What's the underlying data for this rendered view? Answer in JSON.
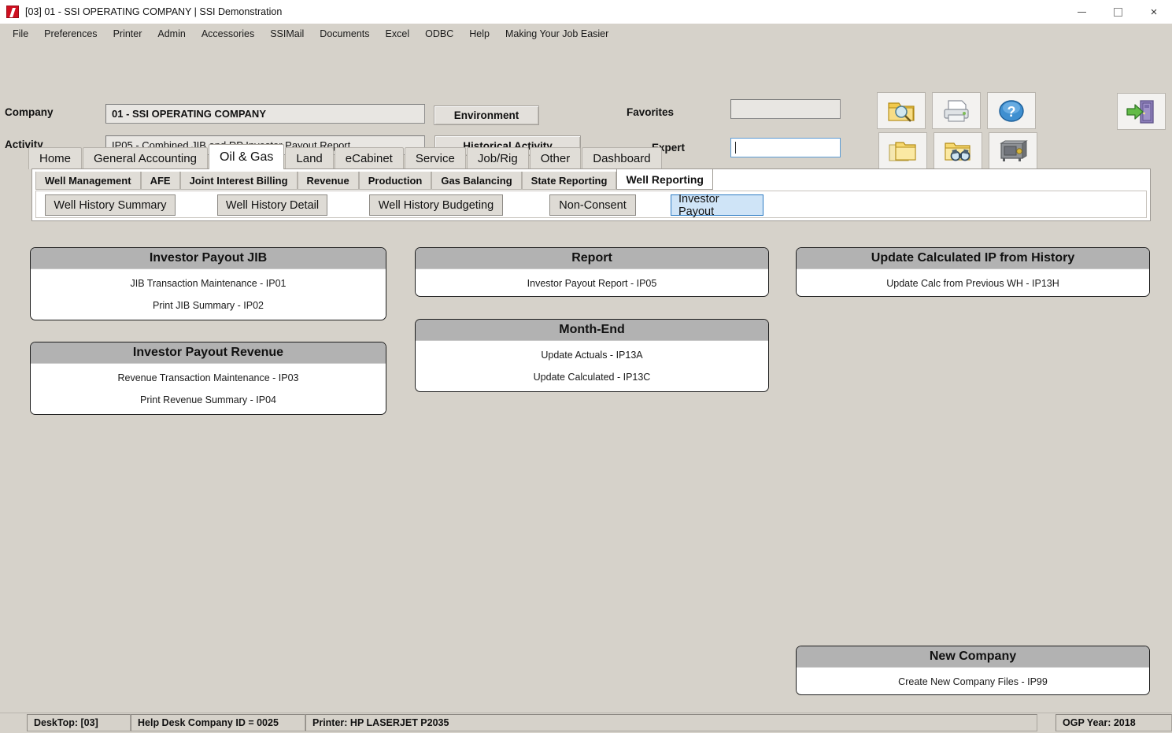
{
  "window": {
    "title": "[03]  01 - SSI OPERATING COMPANY | SSI Demonstration",
    "icon": "ssi-app-icon",
    "minimize_label": "Minimize",
    "maximize_label": "Maximize",
    "close_label": "×"
  },
  "menubar": {
    "items": [
      "File",
      "Preferences",
      "Printer",
      "Admin",
      "Accessories",
      "SSIMail",
      "Documents",
      "Excel",
      "ODBC",
      "Help",
      "Making Your Job Easier"
    ]
  },
  "header": {
    "company_label": "Company",
    "company_value": "01 - SSI OPERATING COMPANY",
    "activity_label": "Activity",
    "activity_value": "IP05 - Combined JIB and RP Investor Payout Report",
    "environment_button": "Environment",
    "historical_activity_button": "Historical Activity",
    "favorites_label": "Favorites",
    "favorites_value": "",
    "expert_label": "Expert",
    "expert_value": "",
    "toolbar_icons": [
      "folder-search-icon",
      "printer-icon",
      "help-question-icon",
      "folders-icon",
      "folder-binoculars-icon",
      "safe-vault-icon"
    ],
    "exit_icon": "exit-door-icon"
  },
  "tabs": {
    "main": [
      {
        "label": "Home",
        "active": false
      },
      {
        "label": "General Accounting",
        "active": false
      },
      {
        "label": "Oil & Gas",
        "active": true
      },
      {
        "label": "Land",
        "active": false
      },
      {
        "label": "eCabinet",
        "active": false
      },
      {
        "label": "Service",
        "active": false
      },
      {
        "label": "Job/Rig",
        "active": false
      },
      {
        "label": "Other",
        "active": false
      },
      {
        "label": "Dashboard",
        "active": false
      }
    ],
    "sub": [
      {
        "label": "Well Management",
        "active": false
      },
      {
        "label": "AFE",
        "active": false
      },
      {
        "label": "Joint Interest Billing",
        "active": false
      },
      {
        "label": "Revenue",
        "active": false
      },
      {
        "label": "Production",
        "active": false
      },
      {
        "label": "Gas Balancing",
        "active": false
      },
      {
        "label": "State Reporting",
        "active": false
      },
      {
        "label": "Well Reporting",
        "active": true
      }
    ],
    "buttons": [
      {
        "label": "Well History Summary",
        "selected": false
      },
      {
        "label": "Well History Detail",
        "selected": false
      },
      {
        "label": "Well History Budgeting",
        "selected": false
      },
      {
        "label": "Non-Consent",
        "selected": false
      },
      {
        "label": "Investor Payout",
        "selected": true
      }
    ]
  },
  "panels": {
    "investor_payout_jib": {
      "title": "Investor Payout JIB",
      "links": [
        "JIB Transaction Maintenance - IP01",
        "Print JIB Summary - IP02"
      ]
    },
    "investor_payout_revenue": {
      "title": "Investor Payout Revenue",
      "links": [
        "Revenue Transaction Maintenance - IP03",
        "Print Revenue Summary - IP04"
      ]
    },
    "report": {
      "title": "Report",
      "links": [
        "Investor Payout Report - IP05"
      ]
    },
    "month_end": {
      "title": "Month-End",
      "links": [
        "Update Actuals - IP13A",
        "Update Calculated - IP13C"
      ]
    },
    "update_calculated_ip": {
      "title": "Update Calculated IP from History",
      "links": [
        "Update Calc from Previous WH - IP13H"
      ]
    },
    "new_company": {
      "title": "New Company",
      "links": [
        "Create New Company Files - IP99"
      ]
    }
  },
  "statusbar": {
    "desktop": "DeskTop:  [03]",
    "help_desk": "Help Desk Company ID = 0025",
    "printer": "Printer: HP LASERJET P2035",
    "ogp_year": "OGP Year:  2018"
  },
  "colors": {
    "accent_selected": "#cfe4f7",
    "accent_border": "#2e7cc4",
    "panel_header": "#b2b2b2",
    "window_chrome": "#d6d2ca"
  }
}
